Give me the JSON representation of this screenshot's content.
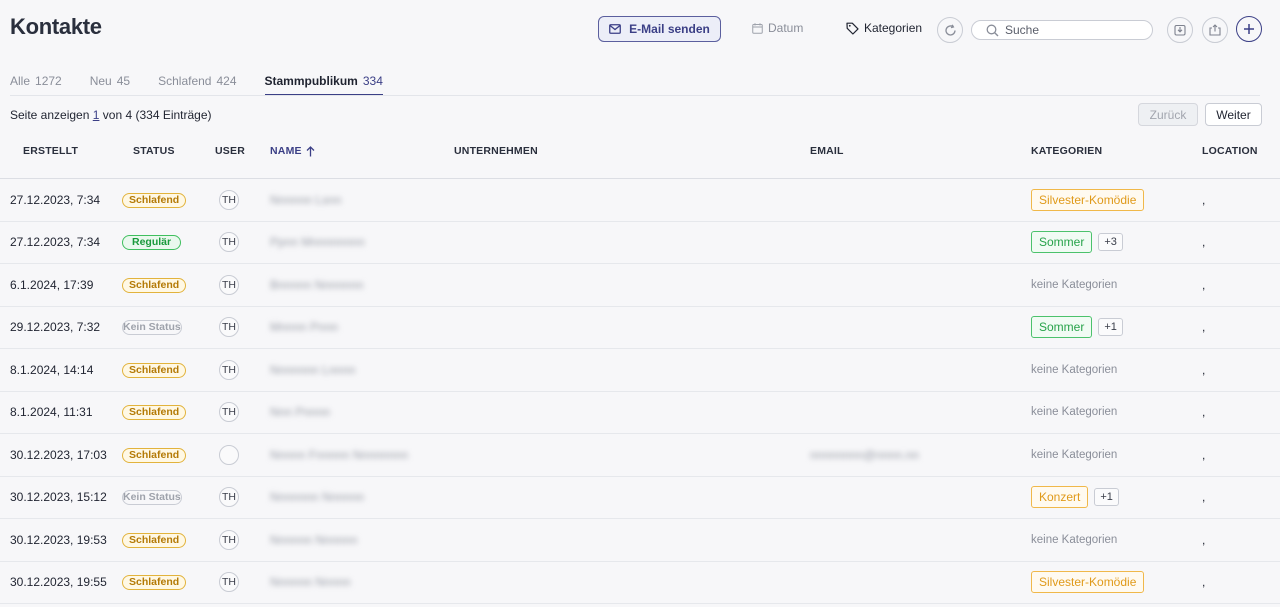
{
  "header": {
    "title": "Kontakte",
    "email_button": "E-Mail senden",
    "date_label": "Datum",
    "categories_label": "Kategorien",
    "search_placeholder": "Suche"
  },
  "tabs": [
    {
      "label": "Alle",
      "count": "1272",
      "active": false
    },
    {
      "label": "Neu",
      "count": "45",
      "active": false
    },
    {
      "label": "Schlafend",
      "count": "424",
      "active": false
    },
    {
      "label": "Stammpublikum",
      "count": "334",
      "active": true
    }
  ],
  "pagination": {
    "prefix": "Seite anzeigen",
    "page": "1",
    "suffix": "von 4 (334 Einträge)",
    "back_label": "Zurück",
    "next_label": "Weiter"
  },
  "columns": {
    "created": "ERSTELLT",
    "status": "STATUS",
    "user": "USER",
    "name": "NAME",
    "company": "UNTERNEHMEN",
    "email": "EMAIL",
    "categories": "KATEGORIEN",
    "location": "LOCATION"
  },
  "rows": [
    {
      "created": "27.12.2023, 7:34",
      "status": "Schlafend",
      "status_type": "schlafend",
      "user": "TH",
      "name": "Nnnnnn Lsnn",
      "email": "",
      "cat": "Silvester-Komödie",
      "cat_color": "orange",
      "more": "",
      "location": ","
    },
    {
      "created": "27.12.2023, 7:34",
      "status": "Regulär",
      "status_type": "regular",
      "user": "TH",
      "name": "Ppnn Mnnnnnnnn",
      "email": "",
      "cat": "Sommer",
      "cat_color": "green",
      "more": "+3",
      "location": ","
    },
    {
      "created": "6.1.2024, 17:39",
      "status": "Schlafend",
      "status_type": "schlafend",
      "user": "TH",
      "name": "Bnnnnn Nnnnnnn",
      "email": "",
      "cat": "",
      "cat_color": "",
      "more": "",
      "location": ","
    },
    {
      "created": "29.12.2023, 7:32",
      "status": "Kein Status",
      "status_type": "none",
      "user": "TH",
      "name": "Mnnnn Pnnn",
      "email": "",
      "cat": "Sommer",
      "cat_color": "green",
      "more": "+1",
      "location": ","
    },
    {
      "created": "8.1.2024, 14:14",
      "status": "Schlafend",
      "status_type": "schlafend",
      "user": "TH",
      "name": "Nnnnnnn Lnnnn",
      "email": "",
      "cat": "",
      "cat_color": "",
      "more": "",
      "location": ","
    },
    {
      "created": "8.1.2024, 11:31",
      "status": "Schlafend",
      "status_type": "schlafend",
      "user": "TH",
      "name": "Nnn Pnnnn",
      "email": "",
      "cat": "",
      "cat_color": "",
      "more": "",
      "location": ","
    },
    {
      "created": "30.12.2023, 17:03",
      "status": "Schlafend",
      "status_type": "schlafend",
      "user": "",
      "name": "Nnnnn Fnnnnn Nnnnnnnn",
      "email": "nnnnnnnn@nnnn.nn",
      "cat": "",
      "cat_color": "",
      "more": "",
      "location": ","
    },
    {
      "created": "30.12.2023, 15:12",
      "status": "Kein Status",
      "status_type": "none",
      "user": "TH",
      "name": "Nnnnnnn Nnnnnn",
      "email": "",
      "cat": "Konzert",
      "cat_color": "orange",
      "more": "+1",
      "location": ","
    },
    {
      "created": "30.12.2023, 19:53",
      "status": "Schlafend",
      "status_type": "schlafend",
      "user": "TH",
      "name": "Nnnnnn Nnnnnn",
      "email": "",
      "cat": "",
      "cat_color": "",
      "more": "",
      "location": ","
    },
    {
      "created": "30.12.2023, 19:55",
      "status": "Schlafend",
      "status_type": "schlafend",
      "user": "TH",
      "name": "Nnnnnn Nnnnn",
      "email": "",
      "cat": "Silvester-Komödie",
      "cat_color": "orange",
      "more": "",
      "location": ","
    }
  ],
  "no_categories_text": "keine Kategorien",
  "colors": {
    "accent": "#3b3f86",
    "schlafend": "#e2b33c",
    "regular": "#3fbf5e"
  }
}
